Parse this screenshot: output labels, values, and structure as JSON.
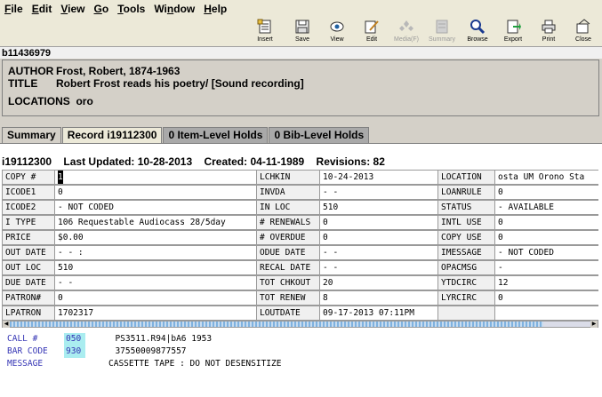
{
  "menu": {
    "items": [
      {
        "pre": "",
        "u": "F",
        "post": "ile"
      },
      {
        "pre": "",
        "u": "E",
        "post": "dit"
      },
      {
        "pre": "",
        "u": "V",
        "post": "iew"
      },
      {
        "pre": "",
        "u": "G",
        "post": "o"
      },
      {
        "pre": "",
        "u": "T",
        "post": "ools"
      },
      {
        "pre": "Wi",
        "u": "n",
        "post": "dow"
      },
      {
        "pre": "",
        "u": "H",
        "post": "elp"
      }
    ]
  },
  "toolbar": {
    "insert": "Insert",
    "save": "Save",
    "view": "View",
    "edit": "Edit",
    "media": "Media(F)",
    "summary": "Summary",
    "browse": "Browse",
    "export": "Export",
    "print": "Print",
    "close": "Close"
  },
  "record_number": "b11436979",
  "bib": {
    "author_label": "AUTHOR",
    "author": "Frost, Robert, 1874-1963",
    "title_label": "TITLE",
    "title": "Robert Frost reads his poetry/ [Sound recording]",
    "locations_label": "LOCATIONS",
    "locations": "oro"
  },
  "tabs": [
    "Summary",
    "Record i19112300",
    "0 Item-Level Holds",
    "0 Bib-Level Holds"
  ],
  "item_header": "i19112300    Last Updated: 10-28-2013    Created: 04-11-1989    Revisions: 82",
  "grid": {
    "rows": [
      [
        "COPY #",
        "1",
        "LCHKIN",
        "10-24-2013",
        "LOCATION",
        "osta  UM Orono Sta"
      ],
      [
        "ICODE1",
        "0",
        "INVDA",
        "-  -",
        "LOANRULE",
        "0"
      ],
      [
        "ICODE2",
        "- NOT CODED",
        "IN LOC",
        "510",
        "STATUS",
        "- AVAILABLE"
      ],
      [
        "I TYPE",
        "106 Requestable Audiocass 28/5day",
        "# RENEWALS",
        "0",
        "INTL USE",
        "0"
      ],
      [
        "PRICE",
        "$0.00",
        "# OVERDUE",
        "0",
        "COPY USE",
        "0"
      ],
      [
        "OUT DATE",
        "-  -      :",
        "ODUE DATE",
        "-  -",
        "IMESSAGE",
        "- NOT CODED"
      ],
      [
        "OUT LOC",
        "510",
        "RECAL DATE",
        "-  -",
        "OPACMSG",
        "-"
      ],
      [
        "DUE DATE",
        "-  -",
        "TOT CHKOUT",
        "20",
        "YTDCIRC",
        "12"
      ],
      [
        "PATRON#",
        "0",
        "TOT RENEW",
        "8",
        "LYRCIRC",
        "0"
      ],
      [
        "LPATRON",
        "1702317",
        "LOUTDATE",
        "09-17-2013 07:11PM",
        "",
        ""
      ]
    ]
  },
  "varfields": [
    {
      "label": "CALL #",
      "tag": "050",
      "text": "PS3511.R94|bA6 1953"
    },
    {
      "label": "BAR CODE",
      "tag": "930",
      "text": "37550009877557"
    },
    {
      "label": "MESSAGE",
      "tag": "",
      "text": "CASSETTE TAPE : DO NOT DESENSITIZE"
    }
  ]
}
